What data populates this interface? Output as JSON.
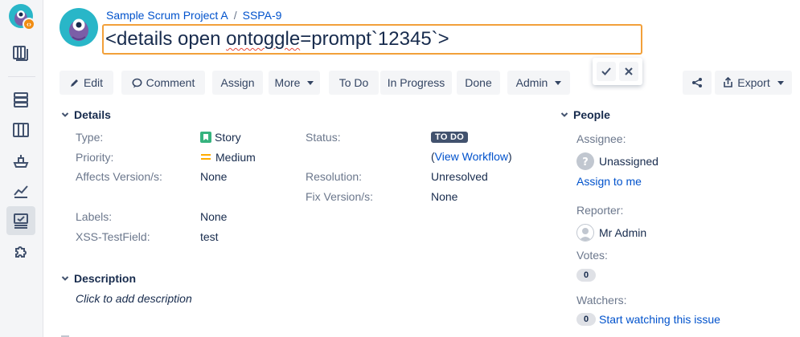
{
  "breadcrumb": {
    "project": "Sample Scrum Project A",
    "separator": "/",
    "issue_key": "SSPA-9"
  },
  "summary": {
    "prefix": "<details open ",
    "misspelled": "ontoggle",
    "suffix": "=prompt`12345`>"
  },
  "app_badge": "‹›",
  "toolbar": {
    "edit": "Edit",
    "comment": "Comment",
    "assign": "Assign",
    "more": "More",
    "todo": "To Do",
    "in_progress": "In Progress",
    "done": "Done",
    "admin": "Admin",
    "export": "Export"
  },
  "details": {
    "heading": "Details",
    "type_label": "Type:",
    "type_value": "Story",
    "priority_label": "Priority:",
    "priority_value": "Medium",
    "affects_label": "Affects Version/s:",
    "affects_value": "None",
    "labels_label": "Labels:",
    "labels_value": "None",
    "xss_label": "XSS-TestField:",
    "xss_value": "test",
    "status_label": "Status:",
    "status_value": "TO DO",
    "workflow_open": "(",
    "workflow_link": "View Workflow",
    "workflow_close": ")",
    "resolution_label": "Resolution:",
    "resolution_value": "Unresolved",
    "fix_label": "Fix Version/s:",
    "fix_value": "None"
  },
  "description": {
    "heading": "Description",
    "placeholder": "Click to add description"
  },
  "people": {
    "heading": "People",
    "assignee_label": "Assignee:",
    "assignee_value": "Unassigned",
    "assign_to_me": "Assign to me",
    "reporter_label": "Reporter:",
    "reporter_value": "Mr Admin",
    "votes_label": "Votes:",
    "votes_count": "0",
    "watchers_label": "Watchers:",
    "watchers_count": "0",
    "watch_link": "Start watching this issue"
  },
  "colors": {
    "accent": "#0052CC",
    "edit_border": "#F2A03A",
    "story_green": "#36B37E",
    "priority_orange": "#FFAB00"
  }
}
